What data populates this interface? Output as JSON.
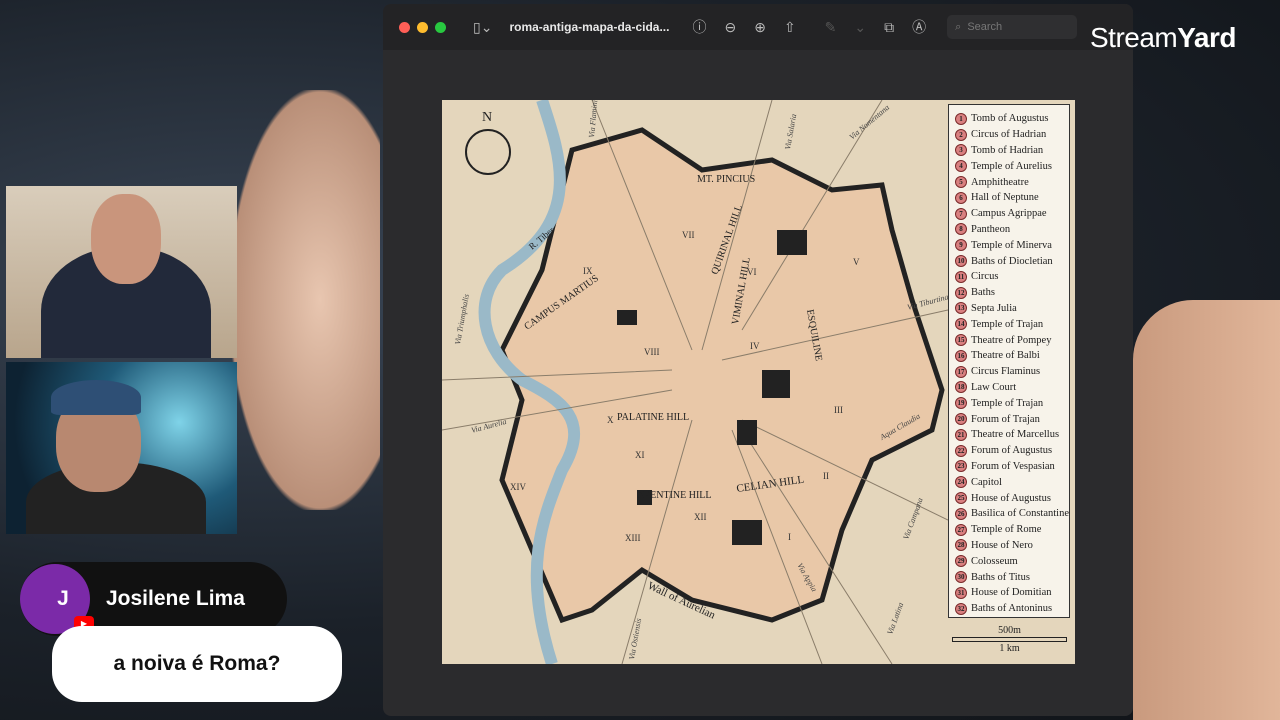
{
  "window": {
    "title": "roma-antiga-mapa-da-cida...",
    "search_placeholder": "Search",
    "traffic_colors": [
      "#ff5f57",
      "#febc2e",
      "#28c840"
    ]
  },
  "brand": {
    "part1": "Stream",
    "part2": "Yard"
  },
  "map": {
    "north": "N",
    "labels": [
      "MT. PINCIUS",
      "QUIRINAL HILL",
      "VIMINAL HILL",
      "ESQUILINE",
      "CAMPUS MARTIUS",
      "PALATINE HILL",
      "AVENTINE HILL",
      "CELIAN HILL",
      "Wall of Aurelian",
      "R. Tiber",
      "Via Flaminia",
      "Via Salaria",
      "Via Nomentana",
      "Via Tiburtina",
      "Via Triumphalis",
      "Via Aurelia",
      "Via Campana",
      "Via Appia",
      "Via Latina",
      "Via Ostiensis",
      "Aqua Claudia",
      "VII",
      "VI",
      "V",
      "IV",
      "III",
      "II",
      "I",
      "IX",
      "VIII",
      "X",
      "XI",
      "XII",
      "XIII",
      "XIV"
    ],
    "legend": [
      "Tomb of Augustus",
      "Circus of Hadrian",
      "Tomb of Hadrian",
      "Temple of Aurelius",
      "Amphitheatre",
      "Hall of Neptune",
      "Campus Agrippae",
      "Pantheon",
      "Temple of Minerva",
      "Baths of Diocletian",
      "Circus",
      "Baths",
      "Septa Julia",
      "Temple of Trajan",
      "Theatre of Pompey",
      "Theatre of Balbi",
      "Circus Flaminus",
      "Law Court",
      "Temple of Trajan",
      "Forum of Trajan",
      "Theatre of Marcellus",
      "Forum of Augustus",
      "Forum of Vespasian",
      "Capitol",
      "House of Augustus",
      "Basilica of Constantine",
      "Temple of Rome",
      "House of Nero",
      "Colosseum",
      "Baths of Titus",
      "House of Domitian",
      "Baths of Antoninus"
    ],
    "scale": {
      "top": "500m",
      "bottom": "1 km"
    }
  },
  "chat": {
    "avatar_letter": "J",
    "name": "Josilene Lima",
    "message": "a noiva é Roma?"
  }
}
